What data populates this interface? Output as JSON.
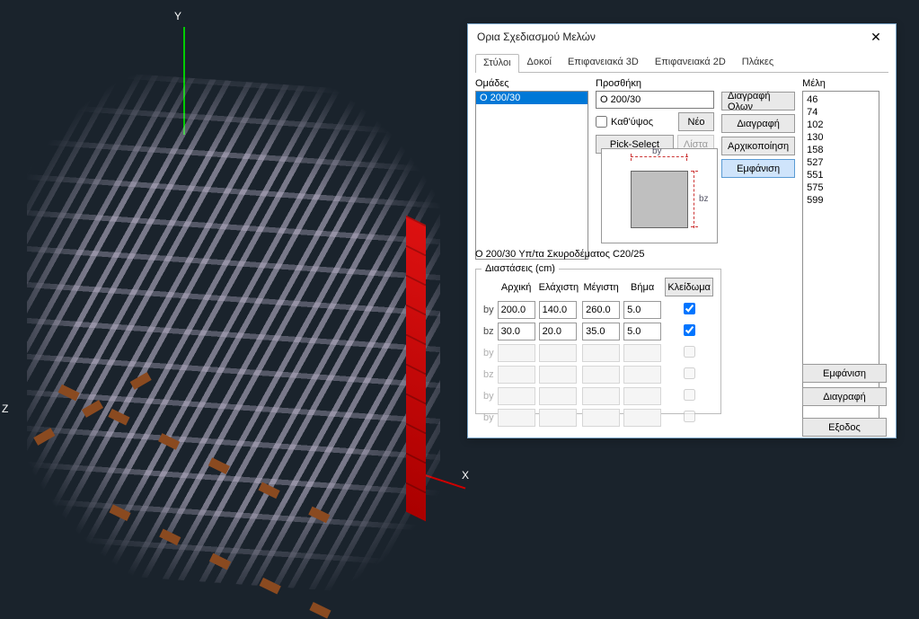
{
  "viewport": {
    "axis_x": "X",
    "axis_y": "Y",
    "axis_z": "Z"
  },
  "dialog": {
    "title": "Ορια Σχεδιασμού Μελών",
    "tabs": [
      "Στύλοι",
      "Δοκοί",
      "Επιφανειακά 3D",
      "Επιφανειακά 2D",
      "Πλάκες"
    ],
    "active_tab_index": 0,
    "groups": {
      "label": "Ομάδες",
      "items": [
        "O 200/30"
      ],
      "selected_index": 0
    },
    "add": {
      "label": "Προσθήκη",
      "value": "O 200/30",
      "per_height_label": "Καθ'ύψος",
      "per_height_checked": false,
      "new_btn": "Νέο",
      "pick_btn": "Pick-Select",
      "list_btn": "Λίστα"
    },
    "side_buttons": {
      "delete_all": "Διαγραφή Ολων",
      "delete": "Διαγραφή",
      "reset": "Αρχικοποίηση",
      "show": "Εμφάνιση"
    },
    "members": {
      "label": "Μέλη",
      "items": [
        "46",
        "74",
        "102",
        "130",
        "158",
        "527",
        "551",
        "575",
        "599"
      ]
    },
    "preview": {
      "by_label": "by",
      "bz_label": "bz"
    },
    "description": "O 200/30 Υπ/τα Σκυροδέματος C20/25",
    "dimensions": {
      "legend": "Διαστάσεις (cm)",
      "headers": [
        "Αρχική",
        "Ελάχιστη",
        "Μέγιστη",
        "Βήμα"
      ],
      "lock_header": "Κλείδωμα",
      "rows": [
        {
          "name": "by",
          "initial": "200.0",
          "min": "140.0",
          "max": "260.0",
          "step": "5.0",
          "locked": true,
          "enabled": true
        },
        {
          "name": "bz",
          "initial": "30.0",
          "min": "20.0",
          "max": "35.0",
          "step": "5.0",
          "locked": true,
          "enabled": true
        },
        {
          "name": "by",
          "initial": "",
          "min": "",
          "max": "",
          "step": "",
          "locked": false,
          "enabled": false
        },
        {
          "name": "bz",
          "initial": "",
          "min": "",
          "max": "",
          "step": "",
          "locked": false,
          "enabled": false
        },
        {
          "name": "by",
          "initial": "",
          "min": "",
          "max": "",
          "step": "",
          "locked": false,
          "enabled": false
        },
        {
          "name": "by",
          "initial": "",
          "min": "",
          "max": "",
          "step": "",
          "locked": false,
          "enabled": false
        }
      ]
    },
    "bottom_buttons": {
      "show": "Εμφάνιση",
      "delete": "Διαγραφή",
      "exit": "Εξοδος"
    }
  }
}
